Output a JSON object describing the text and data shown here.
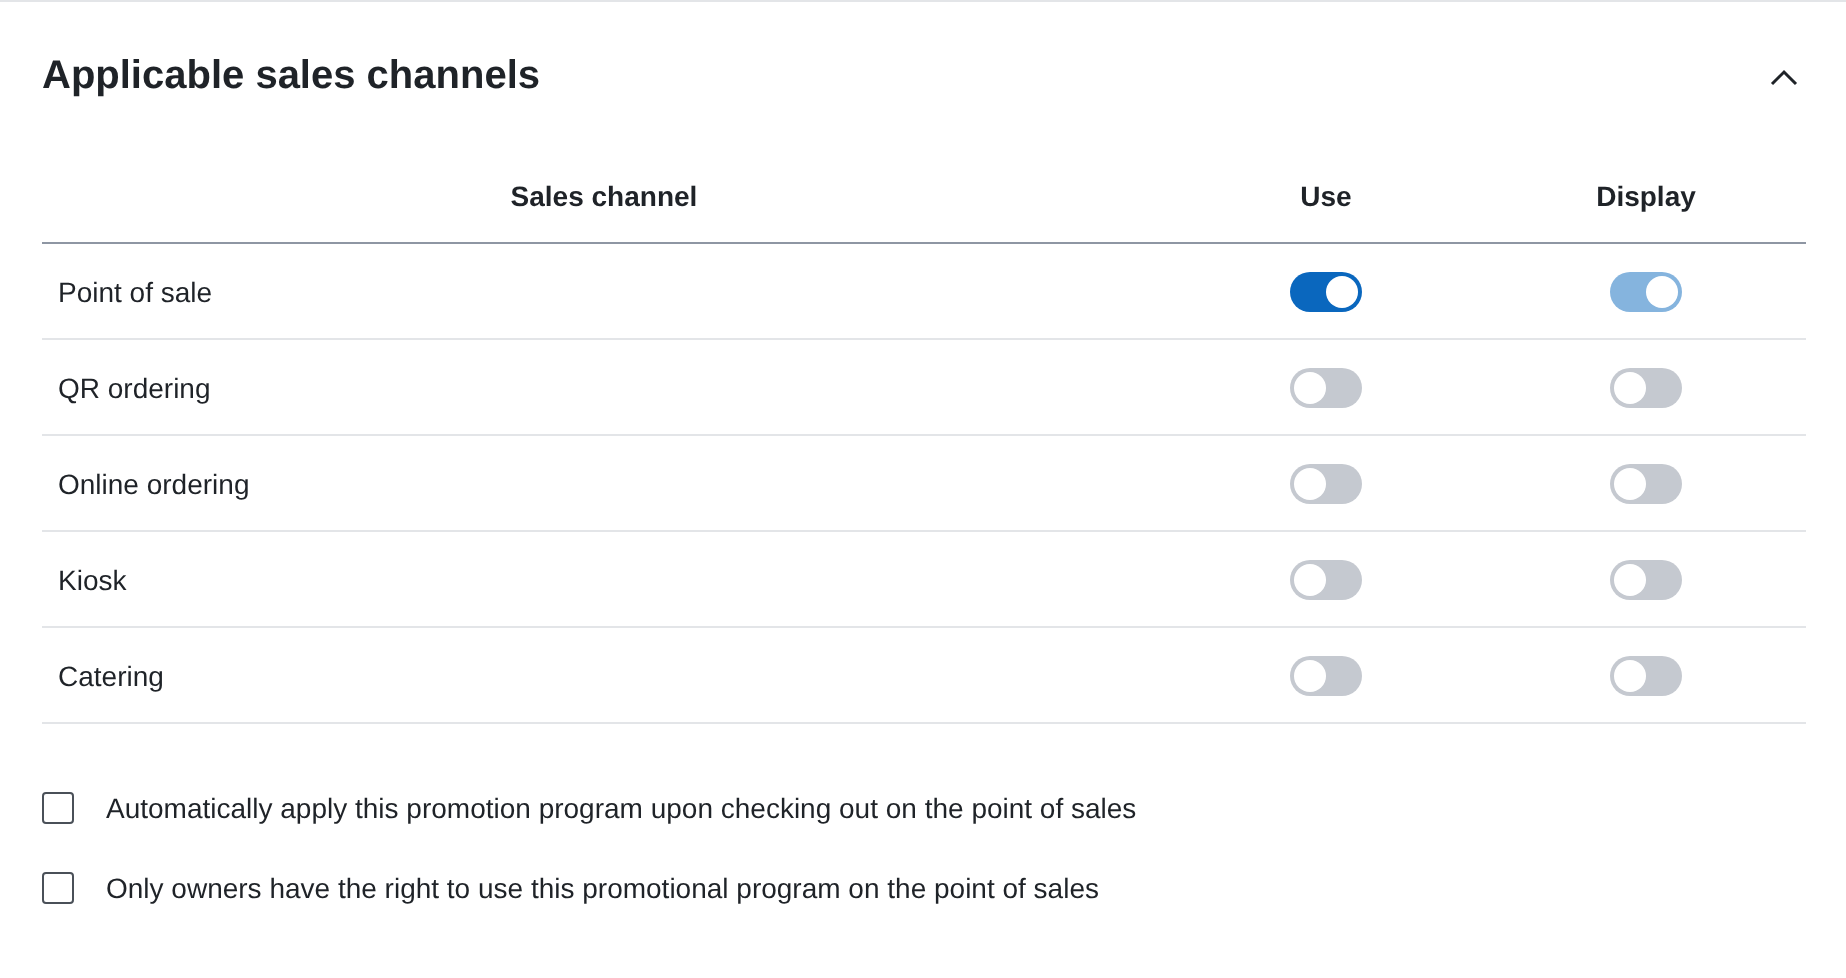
{
  "section": {
    "title": "Applicable sales channels",
    "expanded": true
  },
  "table": {
    "columns": [
      "Sales channel",
      "Use",
      "Display"
    ],
    "rows": [
      {
        "channel": "Point of sale",
        "use": {
          "on": true,
          "disabled": false
        },
        "display": {
          "on": true,
          "disabled": true
        }
      },
      {
        "channel": "QR ordering",
        "use": {
          "on": false,
          "disabled": false
        },
        "display": {
          "on": false,
          "disabled": false
        }
      },
      {
        "channel": "Online ordering",
        "use": {
          "on": false,
          "disabled": false
        },
        "display": {
          "on": false,
          "disabled": false
        }
      },
      {
        "channel": "Kiosk",
        "use": {
          "on": false,
          "disabled": false
        },
        "display": {
          "on": false,
          "disabled": false
        }
      },
      {
        "channel": "Catering",
        "use": {
          "on": false,
          "disabled": false
        },
        "display": {
          "on": false,
          "disabled": false
        }
      }
    ]
  },
  "options": [
    {
      "label": "Automatically apply this promotion program upon checking out on the point of sales",
      "checked": false
    },
    {
      "label": "Only owners have the right to use this promotional program on the point of sales",
      "checked": false
    }
  ]
}
